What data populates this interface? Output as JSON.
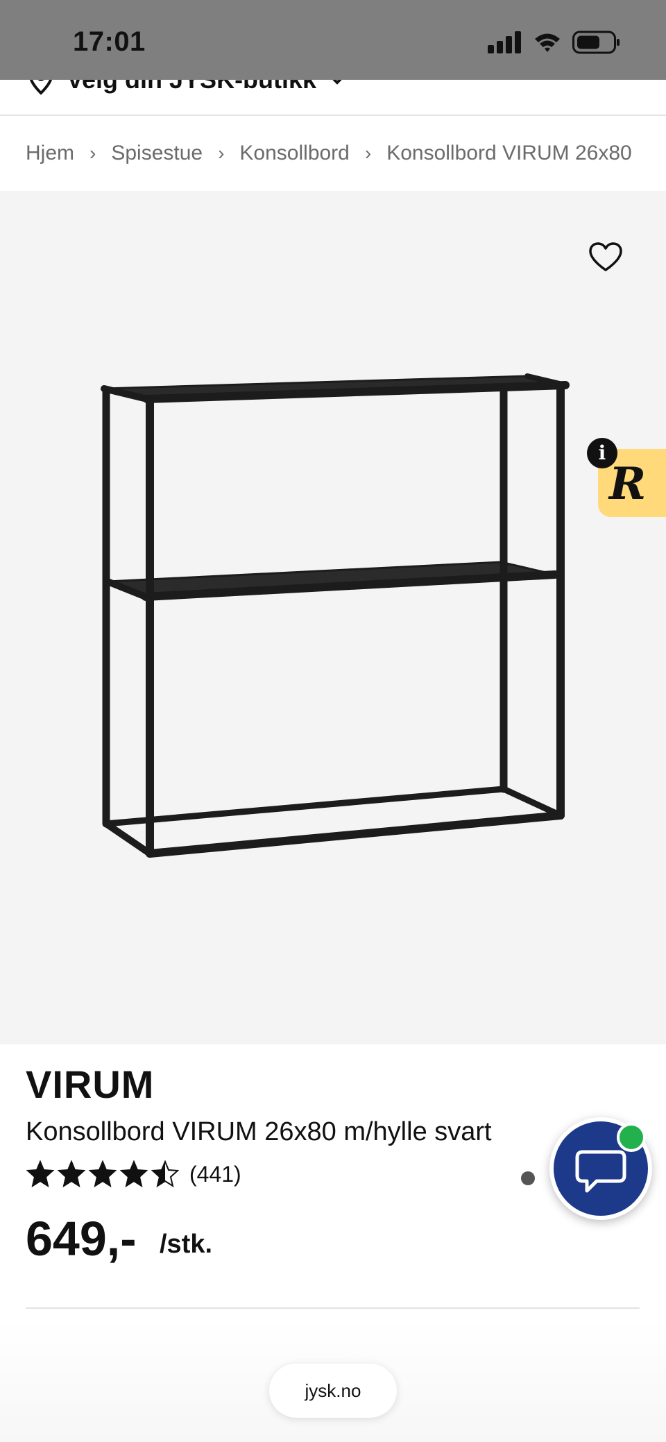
{
  "status_bar": {
    "time": "17:01"
  },
  "store": {
    "label": "Velg din JYSK-butikk"
  },
  "breadcrumb": [
    "Hjem",
    "Spisestue",
    "Konsollbord",
    "Konsollbord VIRUM 26x80"
  ],
  "gallery": {
    "active_index": 0,
    "count": 4
  },
  "product": {
    "brand": "VIRUM",
    "name": "Konsollbord VIRUM 26x80 m/hylle svart",
    "rating": 4.5,
    "reviews": "(441)",
    "price": "649,-",
    "unit": "/stk."
  },
  "badges": {
    "info": "i",
    "r_logo": "R"
  },
  "browser": {
    "url": "jysk.no"
  },
  "colors": {
    "chat": "#1d3a8a",
    "online": "#22b14c",
    "badge": "#ffd97a"
  }
}
